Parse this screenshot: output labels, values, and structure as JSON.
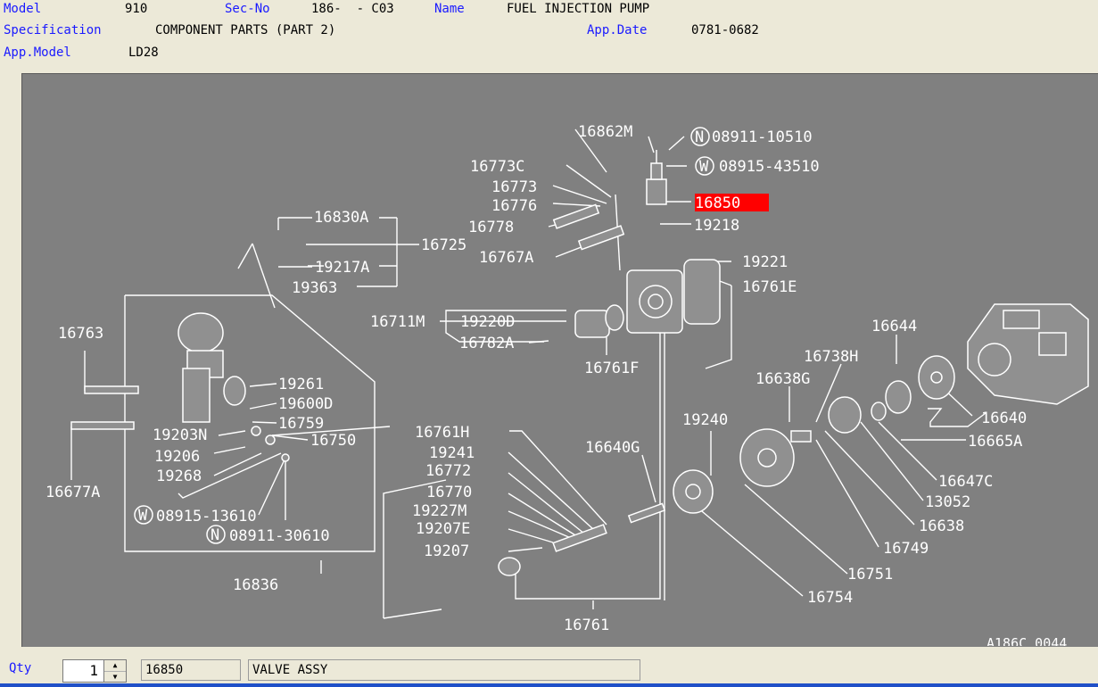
{
  "header": {
    "model_label": "Model",
    "model_value": "910",
    "secno_label": "Sec-No",
    "secno_value": "186-  - C03",
    "name_label": "Name",
    "name_value": "FUEL INJECTION PUMP",
    "spec_label": "Specification",
    "spec_value": "COMPONENT PARTS (PART 2)",
    "appdate_label": "App.Date",
    "appdate_value": "0781-0682",
    "appmodel_label": "App.Model",
    "appmodel_value": "LD28"
  },
  "diagram": {
    "selected_part": "16850",
    "selected_color": "#ff0000",
    "figure_code": "A186C 0044",
    "labels": {
      "p16862M": "16862M",
      "p08911_10510": "08911-10510",
      "p16773C": "16773C",
      "p08915_43510": "08915-43510",
      "p16773": "16773",
      "p16776": "16776",
      "p16850": "16850",
      "p16778": "16778",
      "p19218": "19218",
      "p16830A": "16830A",
      "p16725": "16725",
      "p16767A": "16767A",
      "p19221": "19221",
      "p19217A": "19217A",
      "p19363": "19363",
      "p16761E": "16761E",
      "p16711M": "16711M",
      "p19220D": "19220D",
      "p16782A": "16782A",
      "p16644": "16644",
      "p16763": "16763",
      "p16761F": "16761F",
      "p16738H": "16738H",
      "p16638G": "16638G",
      "p19261": "19261",
      "p19600D": "19600D",
      "p16759": "16759",
      "p16640": "16640",
      "p19240": "19240",
      "p19203N": "19203N",
      "p16750": "16750",
      "p16761H": "16761H",
      "p16665A": "16665A",
      "p19206": "19206",
      "p19241": "19241",
      "p16640G": "16640G",
      "p19268": "19268",
      "p16772": "16772",
      "p16647C": "16647C",
      "p16677A": "16677A",
      "p16770": "16770",
      "p13052": "13052",
      "p08915_13610": "08915-13610",
      "p19227M": "19227M",
      "p16638": "16638",
      "p19207E": "19207E",
      "p08911_30610": "08911-30610",
      "p19207": "19207",
      "p16749": "16749",
      "p16751": "16751",
      "p16836": "16836",
      "p16754": "16754",
      "p16761": "16761",
      "circle_N": "N",
      "circle_W": "W"
    }
  },
  "footer": {
    "qty_label": "Qty",
    "qty_value": "1",
    "part_no": "16850",
    "part_name": "VALVE ASSY"
  }
}
